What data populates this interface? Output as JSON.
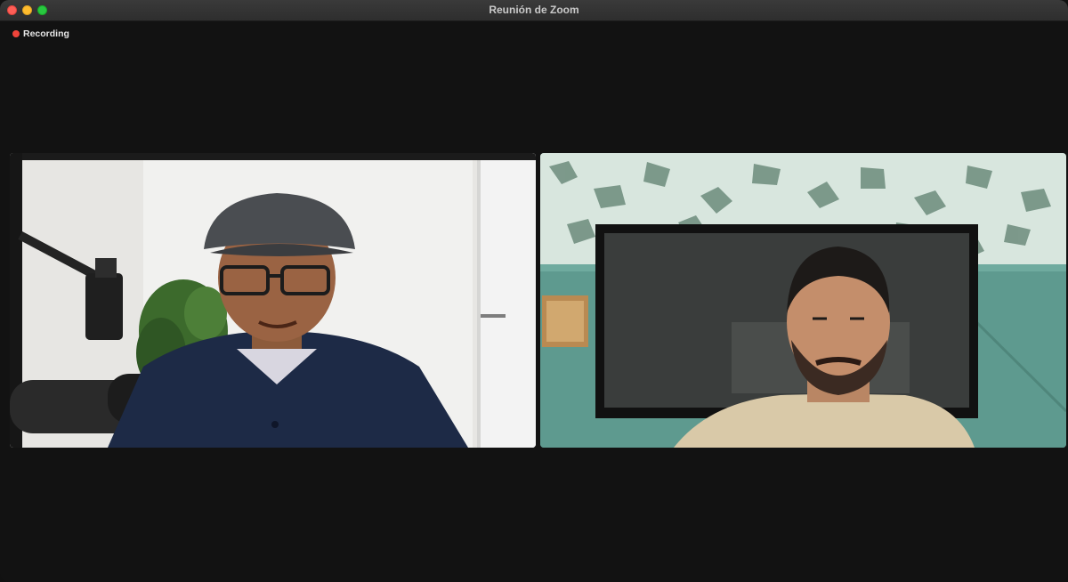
{
  "window": {
    "title": "Reunión de Zoom"
  },
  "recording": {
    "label": "Recording",
    "indicator_color": "#f0443a"
  },
  "participants": [
    {
      "position": "left",
      "description_icon": "video-feed"
    },
    {
      "position": "right",
      "description_icon": "video-feed"
    }
  ],
  "colors": {
    "background": "#121212",
    "titlebar": "#2e2e2e",
    "close": "#fe5f57",
    "minimize": "#febc2e",
    "maximize": "#28c840"
  }
}
